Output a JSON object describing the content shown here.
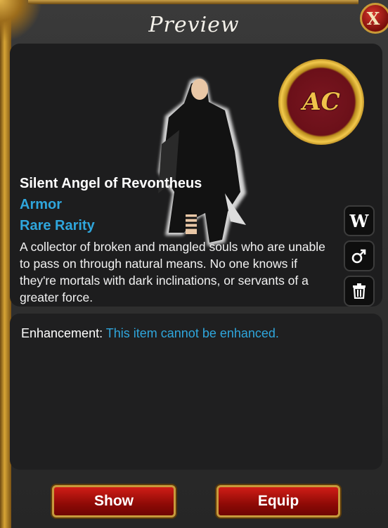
{
  "window": {
    "title": "Preview",
    "close_label": "X"
  },
  "emblem": {
    "text": "AC"
  },
  "item": {
    "name": "Silent Angel of Revontheus",
    "type": "Armor",
    "rarity": "Rare Rarity",
    "description": "A collector of broken and mangled souls who are unable to pass on through natural means. No one knows if they're mortals with dark inclinations, or servants of a greater force."
  },
  "side_buttons": [
    {
      "name": "weapon-view-button",
      "label": "W"
    },
    {
      "name": "gender-toggle-button",
      "icon": "male-symbol-icon"
    },
    {
      "name": "delete-button",
      "icon": "trash-icon"
    }
  ],
  "enhancement": {
    "label": "Enhancement:",
    "value": "This item cannot be enhanced."
  },
  "actions": {
    "show_label": "Show",
    "equip_label": "Equip"
  },
  "colors": {
    "accent_blue": "#2fa6dc",
    "button_red": "#c2160f",
    "gold": "#c79a3c"
  }
}
